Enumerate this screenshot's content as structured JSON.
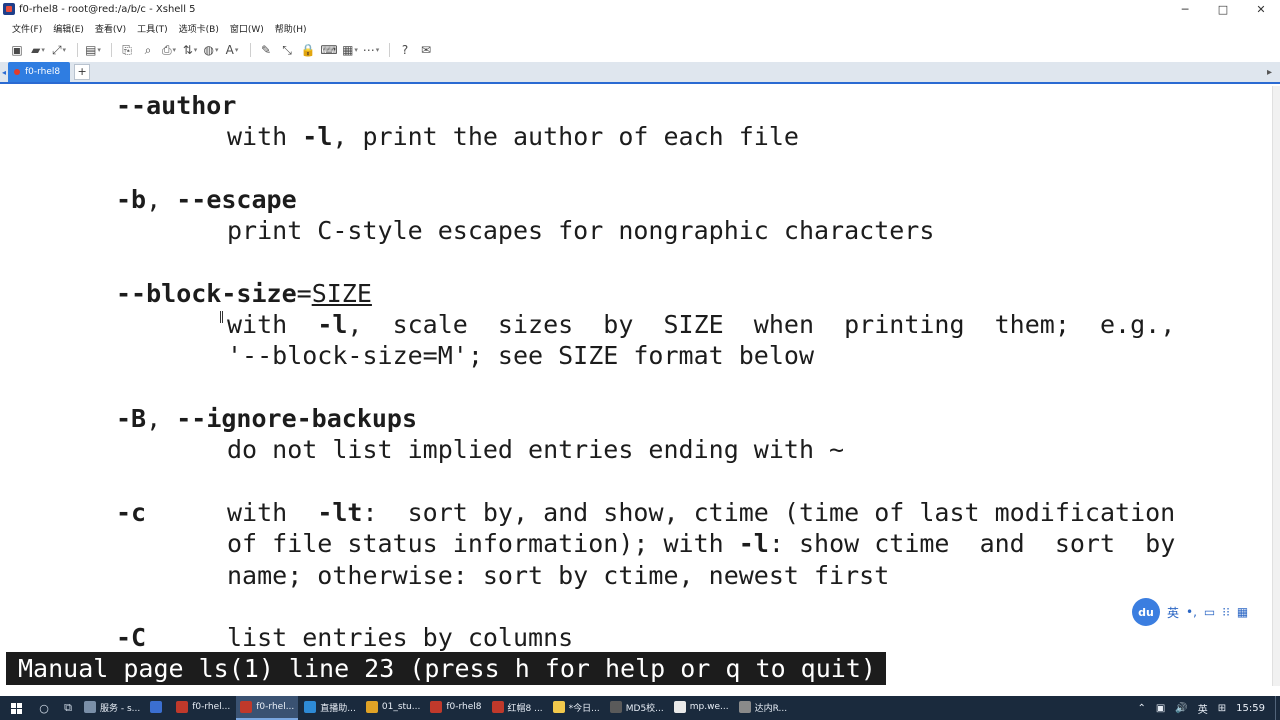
{
  "window": {
    "title": "f0-rhel8 - root@red:/a/b/c - Xshell 5",
    "controls": {
      "minimize": "─",
      "maximize": "□",
      "close": "✕"
    }
  },
  "menu": [
    "文件(F)",
    "编辑(E)",
    "查看(V)",
    "工具(T)",
    "选项卡(B)",
    "窗口(W)",
    "帮助(H)"
  ],
  "toolbar": {
    "buttons": [
      {
        "icon": "new-session-icon",
        "glyph": "▣",
        "drop": false
      },
      {
        "icon": "open-folder-icon",
        "glyph": "▰",
        "drop": true
      },
      {
        "icon": "disconnect-icon",
        "glyph": "⤢",
        "drop": true
      },
      {
        "icon": "properties-icon",
        "glyph": "▤",
        "drop": true
      },
      {
        "icon": "copy-icon",
        "glyph": "⎘",
        "drop": false
      },
      {
        "icon": "find-icon",
        "glyph": "⌕",
        "drop": false
      },
      {
        "icon": "print-icon",
        "glyph": "⎙",
        "drop": true
      },
      {
        "icon": "transfer-icon",
        "glyph": "⇅",
        "drop": true
      },
      {
        "icon": "globe-icon",
        "glyph": "◍",
        "drop": true
      },
      {
        "icon": "font-icon",
        "glyph": "A",
        "drop": true
      },
      {
        "icon": "script-icon",
        "glyph": "✎",
        "drop": false
      },
      {
        "icon": "fullscreen-icon",
        "glyph": "⤡",
        "drop": false
      },
      {
        "icon": "lock-icon",
        "glyph": "🔒",
        "drop": false
      },
      {
        "icon": "keyboard-icon",
        "glyph": "⌨",
        "drop": false
      },
      {
        "icon": "compose-icon",
        "glyph": "▦",
        "drop": true
      },
      {
        "icon": "tunnel-icon",
        "glyph": "⋯",
        "drop": true
      },
      {
        "icon": "help-icon",
        "glyph": "?",
        "drop": false
      },
      {
        "icon": "chat-icon",
        "glyph": "✉",
        "drop": false
      }
    ]
  },
  "tabs": {
    "prev": "◂",
    "items": [
      {
        "label": "f0-rhel8",
        "active": true
      }
    ],
    "add_label": "+",
    "menu_label": "▸"
  },
  "terminal": {
    "lines": [
      {
        "col": 0,
        "row": 0,
        "html": "<b>--author</b>"
      },
      {
        "col": 1,
        "row": 1,
        "html": "with <b>-l</b>, print the author of each file"
      },
      {
        "col": 0,
        "row": 3,
        "html": "<b>-b</b>, <b>--escape</b>"
      },
      {
        "col": 1,
        "row": 4,
        "html": "print C-style escapes for nongraphic characters"
      },
      {
        "col": 0,
        "row": 6,
        "html": "<b>--block-size</b>=<u>SIZE</u>"
      },
      {
        "col": 1,
        "row": 7,
        "html": "with  <b>-l</b>,  scale  sizes  by  SIZE  when  printing  them;  e.g.,"
      },
      {
        "col": 1,
        "row": 8,
        "html": "'--block-size=M'; see SIZE format below"
      },
      {
        "col": 0,
        "row": 10,
        "html": "<b>-B</b>, <b>--ignore-backups</b>"
      },
      {
        "col": 1,
        "row": 11,
        "html": "do not list implied entries ending with ~"
      },
      {
        "col": 0,
        "row": 13,
        "html": "<b>-c</b>"
      },
      {
        "col": 1,
        "row": 13,
        "html": "with  <b>-lt</b>:  sort by, and show, ctime (time of last modification"
      },
      {
        "col": 1,
        "row": 14,
        "html": "of file status information); with <b>-l</b>: show ctime  and  sort  by"
      },
      {
        "col": 1,
        "row": 15,
        "html": "name; otherwise: sort by ctime, newest first"
      },
      {
        "col": 0,
        "row": 17,
        "html": "<b>-C</b>"
      },
      {
        "col": 1,
        "row": 17,
        "html": "list entries by columns"
      }
    ],
    "status": "Manual page ls(1) line 23 (press h for help or q to quit)"
  },
  "ime": {
    "logo": "du",
    "items": [
      {
        "name": "ime-lang-toggle",
        "label": "英"
      },
      {
        "name": "ime-punct-icon",
        "label": "•,"
      },
      {
        "name": "ime-skin-icon",
        "label": "▭"
      },
      {
        "name": "ime-toolbox-icon",
        "label": "⁝⁝"
      },
      {
        "name": "ime-grid-icon",
        "label": "▦"
      }
    ]
  },
  "taskbar": {
    "tasks": [
      {
        "label": "服务 - s...",
        "color": "#7a8fa8",
        "active": false
      },
      {
        "label": "",
        "color": "#3b6fd1",
        "active": false
      },
      {
        "label": "f0-rhel...",
        "color": "#c0392b",
        "active": false
      },
      {
        "label": "f0-rhel...",
        "color": "#c0392b",
        "active": true
      },
      {
        "label": "直播助...",
        "color": "#2e8bd6",
        "active": false
      },
      {
        "label": "01_stu...",
        "color": "#e0a326",
        "active": false
      },
      {
        "label": "f0-rhel8",
        "color": "#c0392b",
        "active": false
      },
      {
        "label": "红帽8 ...",
        "color": "#c0392b",
        "active": false
      },
      {
        "label": "*今日...",
        "color": "#f2c94c",
        "active": false
      },
      {
        "label": "MD5校...",
        "color": "#5a5a5a",
        "active": false
      },
      {
        "label": "mp.we...",
        "color": "#e9e9e9",
        "active": false
      },
      {
        "label": "达内R...",
        "color": "#8a8a8a",
        "active": false
      }
    ],
    "tray": [
      "⌃",
      "▣",
      "🔊",
      "英",
      "⊞",
      "15:59"
    ]
  }
}
